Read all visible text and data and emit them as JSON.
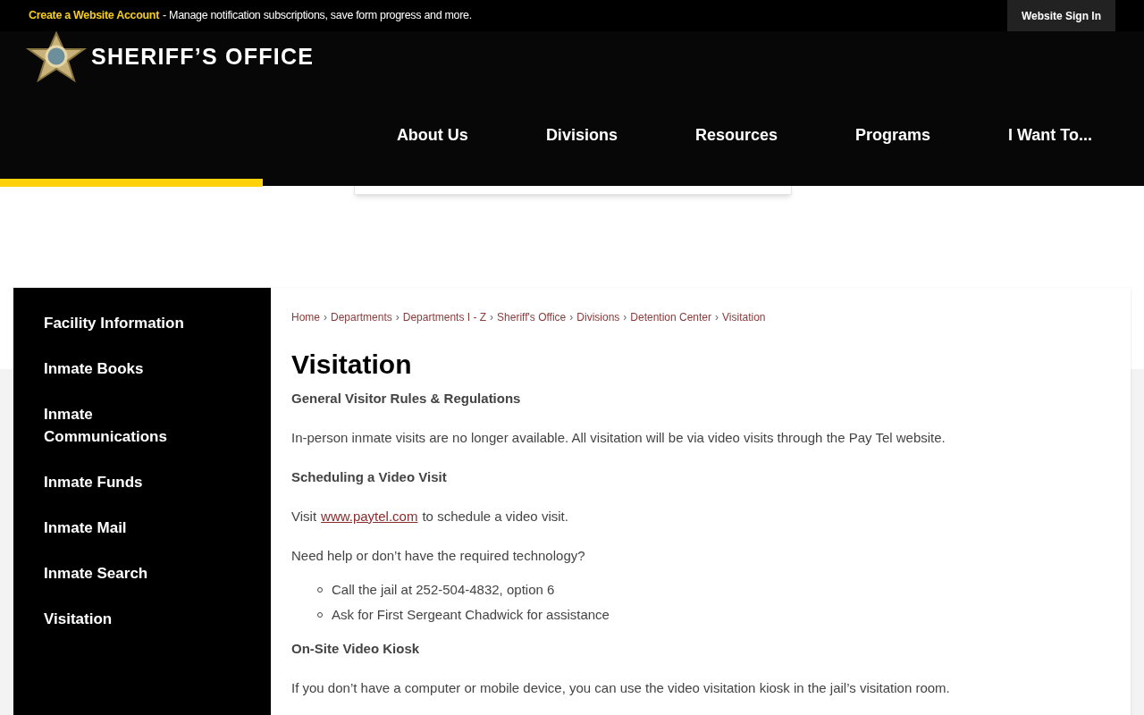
{
  "top_bar": {
    "account_link": "Create a Website Account",
    "account_text": "- Manage notification subscriptions, save form progress and more.",
    "sign_in": "Website Sign In"
  },
  "logo": {
    "title": "SHERIFF’S OFFICE"
  },
  "nav": [
    "About Us",
    "Divisions",
    "Resources",
    "Programs",
    "I Want To..."
  ],
  "sidebar": [
    {
      "label": "Facility Information"
    },
    {
      "label": "Inmate Books"
    },
    {
      "label": "Inmate Communications"
    },
    {
      "label": "Inmate Funds"
    },
    {
      "label": "Inmate Mail"
    },
    {
      "label": "Inmate Search"
    },
    {
      "label": "Visitation"
    }
  ],
  "breadcrumb_separator": "›",
  "breadcrumb": [
    "Home",
    "Departments",
    "Departments I - Z",
    "Sheriff's Office",
    "Divisions",
    "Detention Center",
    "Visitation"
  ],
  "title": "Visitation",
  "content": [
    {
      "kind": "heading",
      "text": "General Visitor Rules & Regulations"
    },
    {
      "kind": "paragraph",
      "text": "In-person inmate visits are no longer available. All visitation will be via video visits through the Pay Tel website."
    },
    {
      "kind": "heading",
      "text": "Scheduling a Video Visit"
    },
    {
      "kind": "link_paragraph",
      "before": "Visit",
      "link": "www.paytel.com",
      "after": "to schedule a video visit."
    },
    {
      "kind": "paragraph",
      "text": "Need help or don’t have the required technology?"
    },
    {
      "kind": "list",
      "items": [
        "Call the jail at 252-504-4832, option 6",
        "Ask for First Sergeant Chadwick for assistance"
      ]
    },
    {
      "kind": "heading",
      "text": "On-Site Video Kiosk"
    },
    {
      "kind": "paragraph",
      "text": "If you don’t have a computer or mobile device, you can use the video visitation kiosk in the jail’s visitation room."
    }
  ]
}
